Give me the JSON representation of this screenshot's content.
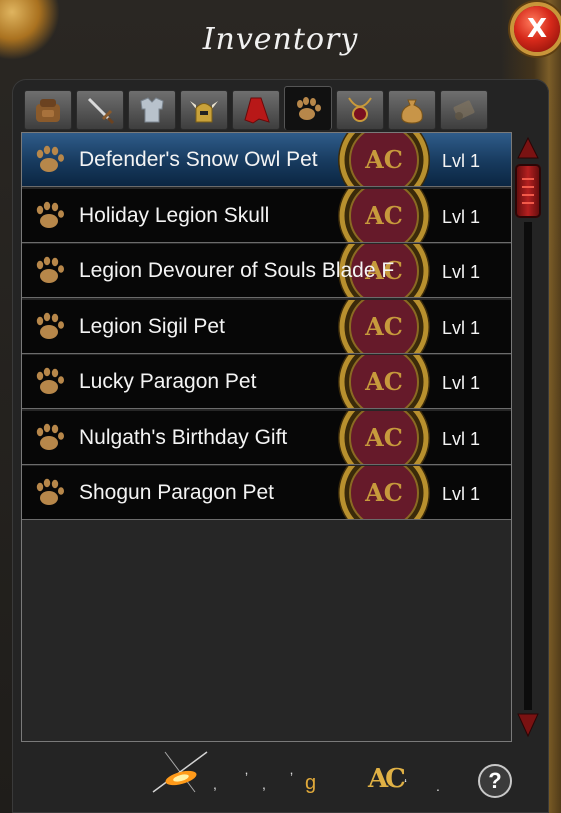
{
  "window": {
    "title": "Inventory",
    "close_label": "X"
  },
  "tabs": [
    {
      "icon": "backpack-icon"
    },
    {
      "icon": "sword-icon"
    },
    {
      "icon": "armor-icon"
    },
    {
      "icon": "helmet-icon"
    },
    {
      "icon": "cape-icon"
    },
    {
      "icon": "pet-paw-icon",
      "active": true
    },
    {
      "icon": "amulet-icon"
    },
    {
      "icon": "item-bag-icon"
    },
    {
      "icon": "scroll-icon"
    }
  ],
  "items": [
    {
      "name": "Defender's Snow Owl Pet",
      "level": "Lvl 1",
      "selected": true
    },
    {
      "name": "Holiday Legion Skull",
      "level": "Lvl 1"
    },
    {
      "name": "Legion Devourer of Souls Blade F",
      "level": "Lvl 1"
    },
    {
      "name": "Legion Sigil Pet",
      "level": "Lvl 1"
    },
    {
      "name": "Lucky Paragon Pet",
      "level": "Lvl 1"
    },
    {
      "name": "Nulgath's Birthday Gift",
      "level": "Lvl 1"
    },
    {
      "name": "Shogun Paragon Pet",
      "level": "Lvl 1"
    }
  ],
  "item_badge": "AC",
  "footer": {
    "gold_suffix": "g",
    "ac_label": "AC",
    "help_label": "?"
  },
  "colors": {
    "selected_row": "#2f5c8a",
    "gold": "#e0a93a",
    "close_red": "#d6291a"
  }
}
